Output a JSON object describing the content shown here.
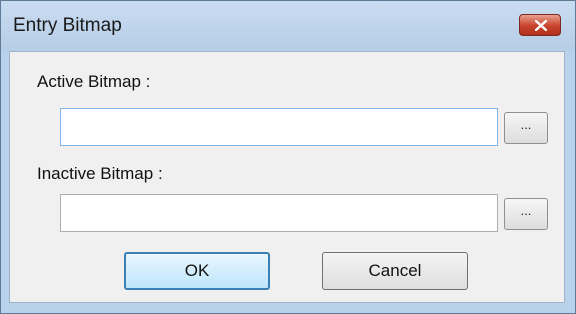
{
  "window": {
    "title": "Entry Bitmap",
    "close_icon": "close-icon"
  },
  "form": {
    "active_label": "Active Bitmap :",
    "active_value": "",
    "active_browse_label": "...",
    "inactive_label": "Inactive Bitmap :",
    "inactive_value": "",
    "inactive_browse_label": "..."
  },
  "buttons": {
    "ok_label": "OK",
    "cancel_label": "Cancel"
  },
  "colors": {
    "close_button": "#c7432c",
    "default_button_border": "#3c7fb1",
    "focus_border": "#7eb4ea"
  }
}
